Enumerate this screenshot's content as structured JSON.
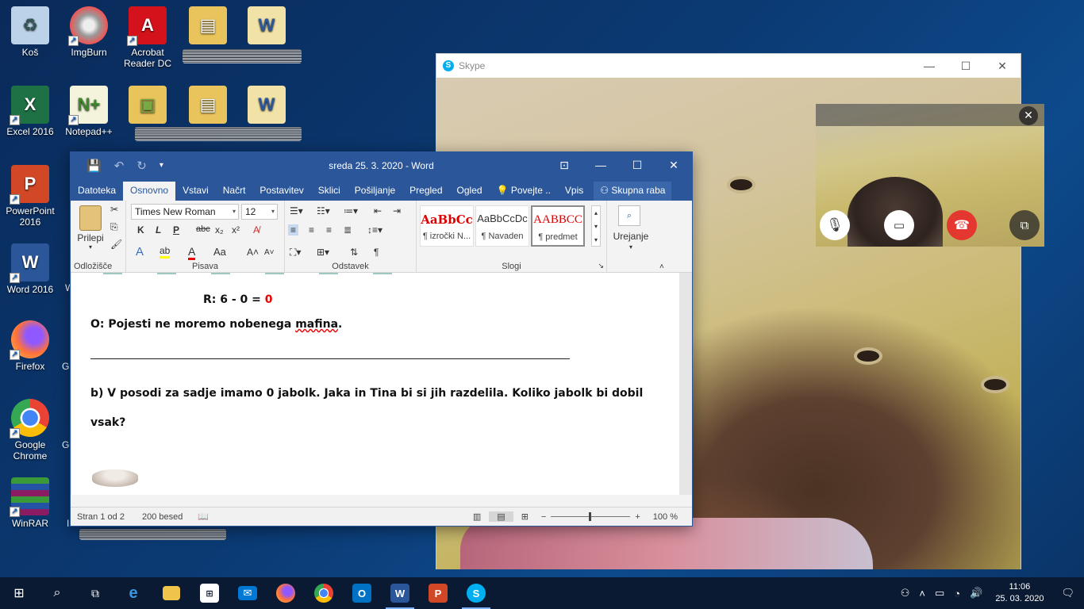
{
  "desktop": {
    "icons": [
      {
        "label": "Koš",
        "icon": "recycle-bin-icon"
      },
      {
        "label": "ImgBurn",
        "icon": "imgburn-icon"
      },
      {
        "label": "Acrobat Reader DC",
        "icon": "acrobat-icon"
      },
      {
        "label": "Excel 2016",
        "icon": "excel-icon"
      },
      {
        "label": "Notepad++",
        "icon": "notepad-plus-icon"
      },
      {
        "label": "PowerPoint 2016",
        "icon": "powerpoint-icon"
      },
      {
        "label": "Word 2016",
        "icon": "word-icon"
      },
      {
        "label": "Firefox",
        "icon": "firefox-icon"
      },
      {
        "label": "Google Chrome",
        "icon": "chrome-icon"
      },
      {
        "label": "WinRAR",
        "icon": "winrar-icon"
      }
    ],
    "partial_labels": {
      "a": "Gl",
      "b": "Go",
      "c": "I",
      "d": "W"
    }
  },
  "skype": {
    "title": "Skype",
    "controls": {
      "mute": "microphone-icon",
      "video": "camera-icon",
      "hangup": "hang-up-icon",
      "switch": "switch-view-icon"
    }
  },
  "word": {
    "title": "sreda 25. 3. 2020  -  Word",
    "tabs": [
      "Datoteka",
      "Osnovno",
      "Vstavi",
      "Načrt",
      "Postavitev",
      "Sklici",
      "Pošiljanje",
      "Pregled",
      "Ogled"
    ],
    "tell_me": "Povejte ..",
    "signin": "Vpis",
    "share": "Skupna raba",
    "ribbon": {
      "paste": "Prilepi",
      "clipboard": "Odložišče",
      "font_name": "Times New Roman",
      "font_size": "12",
      "font_group": "Pisava",
      "paragraph_group": "Odstavek",
      "styles_group": "Slogi",
      "editing": "Urejanje",
      "styles": [
        {
          "sample": "AaBbCc",
          "name": "¶ izročki N..."
        },
        {
          "sample": "AaBbCcDc",
          "name": "¶ Navaden"
        },
        {
          "sample": "AABBCC",
          "name": "¶ predmet"
        }
      ],
      "font_buttons": {
        "bold": "K",
        "italic": "L",
        "underline": "P",
        "strike": "abc",
        "sub": "x₂",
        "sup": "x²",
        "case": "Aa"
      }
    },
    "document": {
      "equation_prefix": "R: 6 - 0 = ",
      "equation_result": "0",
      "answer": "O: Pojesti ne moremo nobenega ",
      "answer_word": "mafina",
      "answer_end": ".",
      "question_line1": "b) V posodi za sadje imamo 0 jabolk. Jaka in Tina bi si jih razdelila. Koliko jabolk bi dobil",
      "question_line2": "vsak?"
    },
    "status": {
      "page": "Stran 1 od 2",
      "words": "200 besed",
      "zoom": "100 %"
    }
  },
  "taskbar": {
    "apps": [
      "start-icon",
      "search-icon",
      "task-view-icon",
      "edge-icon",
      "file-explorer-icon",
      "store-icon",
      "mail-icon",
      "firefox-icon",
      "chrome-icon",
      "outlook-icon",
      "word-icon",
      "powerpoint-icon",
      "skype-icon"
    ],
    "time": "11:06",
    "date": "25. 03. 2020"
  }
}
